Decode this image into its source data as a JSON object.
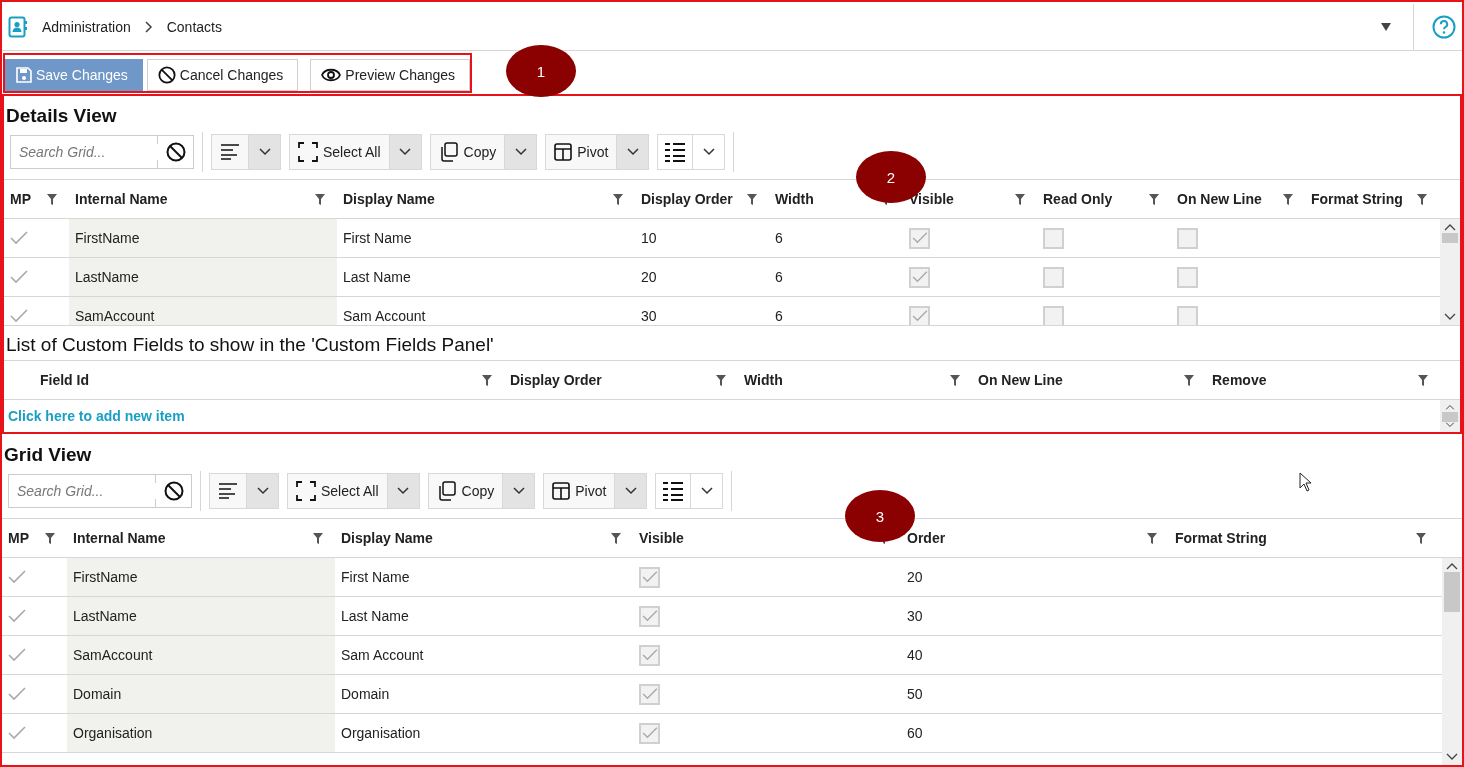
{
  "breadcrumb": {
    "items": [
      "Administration",
      "Contacts"
    ]
  },
  "actions": [
    {
      "label": "Save Changes",
      "kind": "save",
      "selected": true
    },
    {
      "label": "Cancel Changes",
      "kind": "cancel",
      "selected": false
    },
    {
      "label": "Preview Changes",
      "kind": "preview",
      "selected": false
    }
  ],
  "callouts": [
    "1",
    "2",
    "3"
  ],
  "details_view": {
    "title": "Details View",
    "toolbar": {
      "search_placeholder": "Search Grid...",
      "buttons": [
        {
          "kind": "align"
        },
        {
          "kind": "select",
          "label": "Select All"
        },
        {
          "kind": "copy",
          "label": "Copy"
        },
        {
          "kind": "pivot",
          "label": "Pivot"
        },
        {
          "kind": "columns"
        }
      ]
    },
    "columns": [
      "MP",
      "Internal Name",
      "Display Name",
      "Display Order",
      "Width",
      "Visible",
      "Read Only",
      "On New Line",
      "Format String"
    ],
    "rows": [
      {
        "cells": [
          {
            "kind": "tick",
            "checked": true
          },
          {
            "kind": "text",
            "text": "FirstName"
          },
          {
            "kind": "text",
            "text": "First Name"
          },
          {
            "kind": "text",
            "text": "10"
          },
          {
            "kind": "text",
            "text": "6"
          },
          {
            "kind": "check",
            "checked": true
          },
          {
            "kind": "check",
            "checked": false
          },
          {
            "kind": "check",
            "checked": false
          },
          {
            "kind": "empty"
          }
        ]
      },
      {
        "cells": [
          {
            "kind": "tick",
            "checked": true
          },
          {
            "kind": "text",
            "text": "LastName"
          },
          {
            "kind": "text",
            "text": "Last Name"
          },
          {
            "kind": "text",
            "text": "20"
          },
          {
            "kind": "text",
            "text": "6"
          },
          {
            "kind": "check",
            "checked": true
          },
          {
            "kind": "check",
            "checked": false
          },
          {
            "kind": "check",
            "checked": false
          },
          {
            "kind": "empty"
          }
        ]
      },
      {
        "cells": [
          {
            "kind": "tick",
            "checked": true
          },
          {
            "kind": "text",
            "text": "SamAccount"
          },
          {
            "kind": "text",
            "text": "Sam Account"
          },
          {
            "kind": "text",
            "text": "30"
          },
          {
            "kind": "text",
            "text": "6"
          },
          {
            "kind": "check",
            "checked": true
          },
          {
            "kind": "check",
            "checked": false
          },
          {
            "kind": "check",
            "checked": false
          },
          {
            "kind": "empty"
          }
        ]
      }
    ]
  },
  "custom_fields": {
    "title": "List of Custom Fields to show in the 'Custom Fields Panel'",
    "columns": [
      "Field Id",
      "Display Order",
      "Width",
      "On New Line",
      "Remove"
    ],
    "add_link": "Click here to add new item"
  },
  "grid_view": {
    "title": "Grid View",
    "toolbar": {
      "search_placeholder": "Search Grid...",
      "buttons": [
        {
          "kind": "align"
        },
        {
          "kind": "select",
          "label": "Select All"
        },
        {
          "kind": "copy",
          "label": "Copy"
        },
        {
          "kind": "pivot",
          "label": "Pivot"
        },
        {
          "kind": "columns"
        }
      ]
    },
    "columns": [
      "MP",
      "Internal Name",
      "Display Name",
      "Visible",
      "Order",
      "Format String"
    ],
    "rows": [
      {
        "cells": [
          {
            "kind": "tick",
            "checked": true
          },
          {
            "kind": "text",
            "text": "FirstName"
          },
          {
            "kind": "text",
            "text": "First Name"
          },
          {
            "kind": "check",
            "checked": true
          },
          {
            "kind": "text",
            "text": "20"
          },
          {
            "kind": "empty"
          }
        ]
      },
      {
        "cells": [
          {
            "kind": "tick",
            "checked": true
          },
          {
            "kind": "text",
            "text": "LastName"
          },
          {
            "kind": "text",
            "text": "Last Name"
          },
          {
            "kind": "check",
            "checked": true
          },
          {
            "kind": "text",
            "text": "30"
          },
          {
            "kind": "empty"
          }
        ]
      },
      {
        "cells": [
          {
            "kind": "tick",
            "checked": true
          },
          {
            "kind": "text",
            "text": "SamAccount"
          },
          {
            "kind": "text",
            "text": "Sam Account"
          },
          {
            "kind": "check",
            "checked": true
          },
          {
            "kind": "text",
            "text": "40"
          },
          {
            "kind": "empty"
          }
        ]
      },
      {
        "cells": [
          {
            "kind": "tick",
            "checked": true
          },
          {
            "kind": "text",
            "text": "Domain"
          },
          {
            "kind": "text",
            "text": "Domain"
          },
          {
            "kind": "check",
            "checked": true
          },
          {
            "kind": "text",
            "text": "50"
          },
          {
            "kind": "empty"
          }
        ]
      },
      {
        "cells": [
          {
            "kind": "tick",
            "checked": true
          },
          {
            "kind": "text",
            "text": "Organisation"
          },
          {
            "kind": "text",
            "text": "Organisation"
          },
          {
            "kind": "check",
            "checked": true
          },
          {
            "kind": "text",
            "text": "60"
          },
          {
            "kind": "empty"
          }
        ]
      }
    ]
  }
}
